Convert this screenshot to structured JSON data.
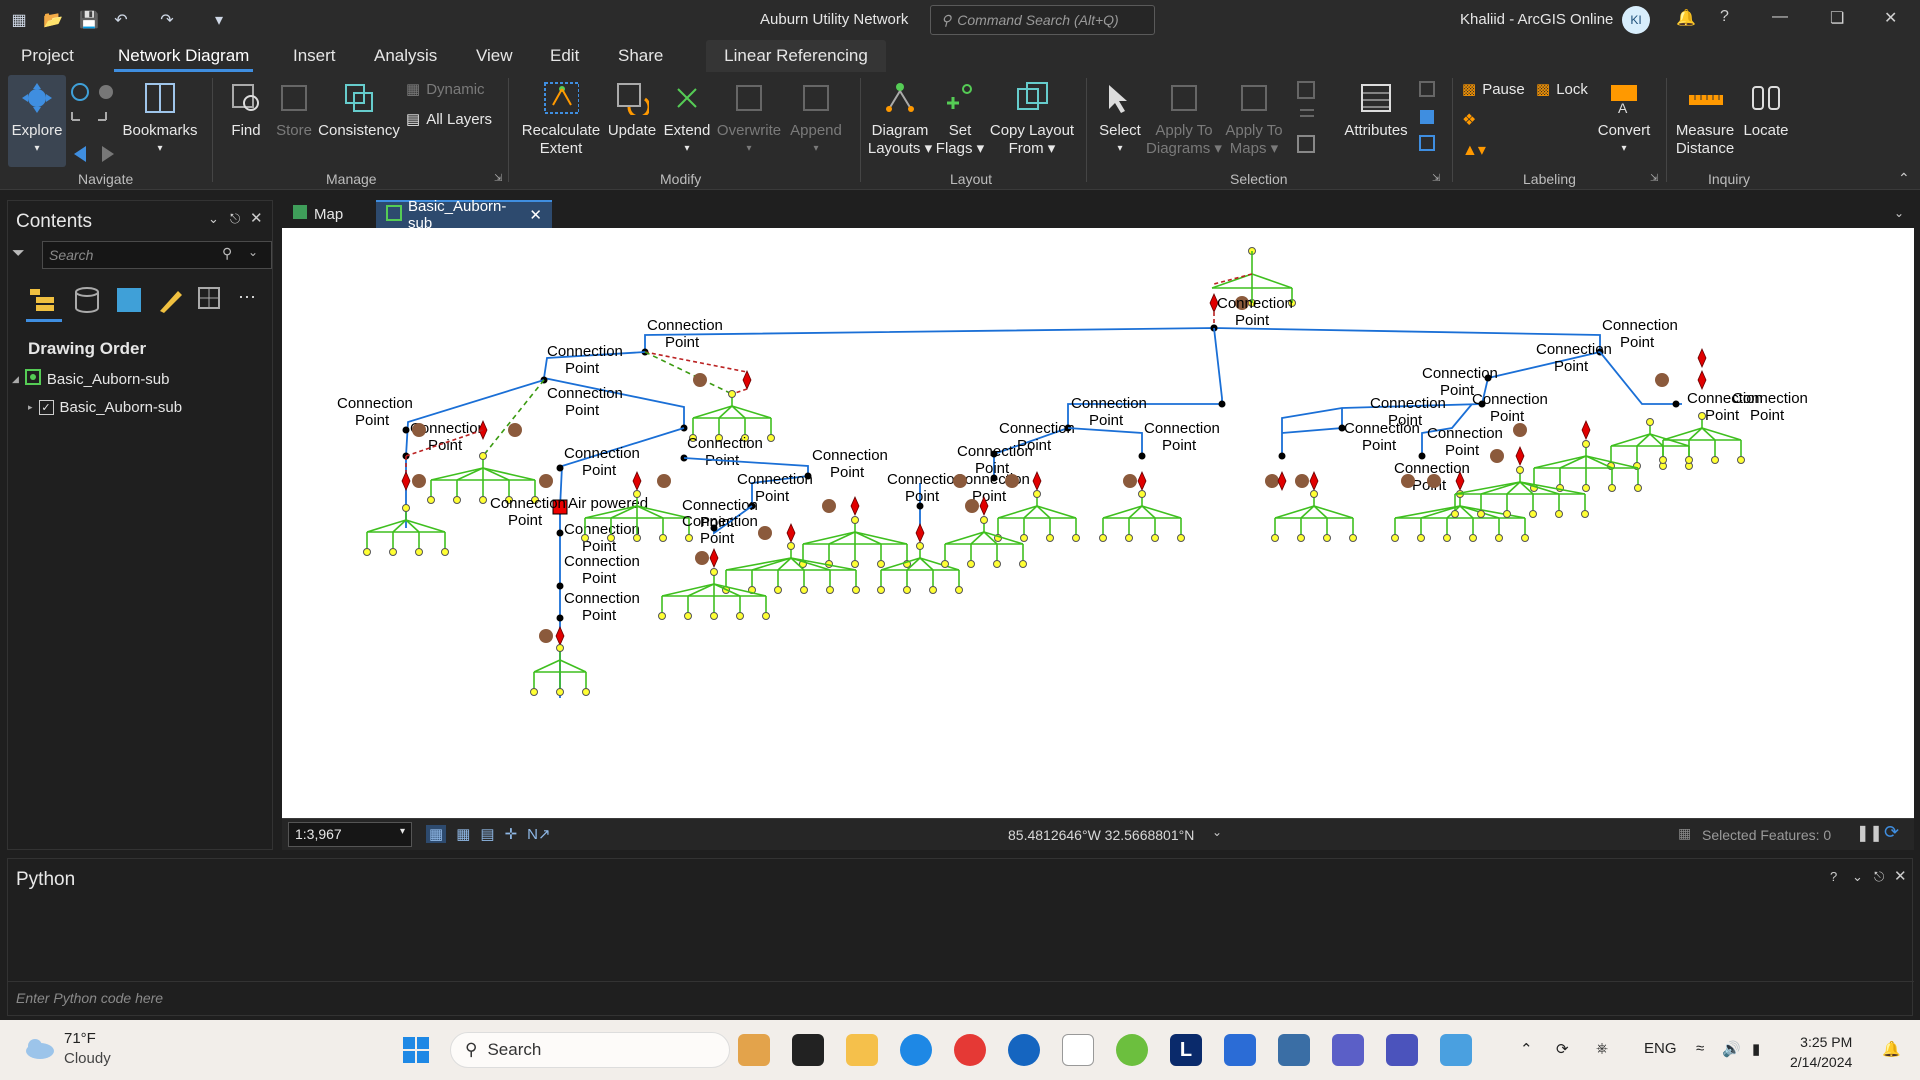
{
  "titlebar": {
    "project_name": "Auburn Utility Network",
    "command_search_placeholder": "Command Search (Alt+Q)",
    "user": "Khaliid - ArcGIS Online",
    "avatar_initials": "KI"
  },
  "tabs": [
    "Project",
    "Network Diagram",
    "Insert",
    "Analysis",
    "View",
    "Edit",
    "Share"
  ],
  "contextual_tab": "Linear Referencing",
  "ribbon": {
    "navigate": {
      "explore": "Explore",
      "bookmarks": "Bookmarks",
      "group": "Navigate"
    },
    "manage": {
      "find": "Find",
      "store": "Store",
      "consistency": "Consistency",
      "dynamic": "Dynamic",
      "all_layers": "All Layers",
      "group": "Manage"
    },
    "modify": {
      "recalculate": "Recalculate",
      "recalculate2": "Extent",
      "update": "Update",
      "extend": "Extend",
      "overwrite": "Overwrite",
      "append": "Append",
      "group": "Modify"
    },
    "layout": {
      "diagram_layouts": "Diagram",
      "diagram_layouts2": "Layouts",
      "set_flags": "Set",
      "set_flags2": "Flags",
      "copy_layout": "Copy Layout",
      "copy_layout2": "From",
      "group": "Layout"
    },
    "selection": {
      "select": "Select",
      "apply_diagrams": "Apply To",
      "apply_diagrams2": "Diagrams",
      "apply_maps": "Apply To",
      "apply_maps2": "Maps",
      "attributes": "Attributes",
      "group": "Selection"
    },
    "labeling": {
      "pause": "Pause",
      "lock": "Lock",
      "convert": "Convert",
      "group": "Labeling"
    },
    "inquiry": {
      "measure": "Measure",
      "measure2": "Distance",
      "locate": "Locate",
      "group": "Inquiry"
    }
  },
  "contents": {
    "title": "Contents",
    "search_placeholder": "Search",
    "drawing_order": "Drawing Order",
    "map_item": "Basic_Auborn-sub",
    "layer_item": "Basic_Auborn-sub"
  },
  "doc_tabs": [
    {
      "label": "Map"
    },
    {
      "label": "Basic_Auborn-sub"
    }
  ],
  "diagram": {
    "label": "Connection",
    "label2": "Point",
    "air_powered": "Air powered",
    "colors": {
      "line": "#1a6fd6",
      "green": "#3fbf1f",
      "junction": "#ffff33",
      "flag": "#e00000",
      "circle": "#8b5a3c"
    }
  },
  "status": {
    "scale": "1:3,967",
    "coords": "85.4812646°W 32.5668801°N",
    "selected": "Selected Features: 0"
  },
  "python": {
    "title": "Python",
    "placeholder": "Enter Python code here"
  },
  "taskbar": {
    "temp": "71°F",
    "weather": "Cloudy",
    "search": "Search",
    "lang": "ENG",
    "time": "3:25 PM",
    "date": "2/14/2024"
  }
}
